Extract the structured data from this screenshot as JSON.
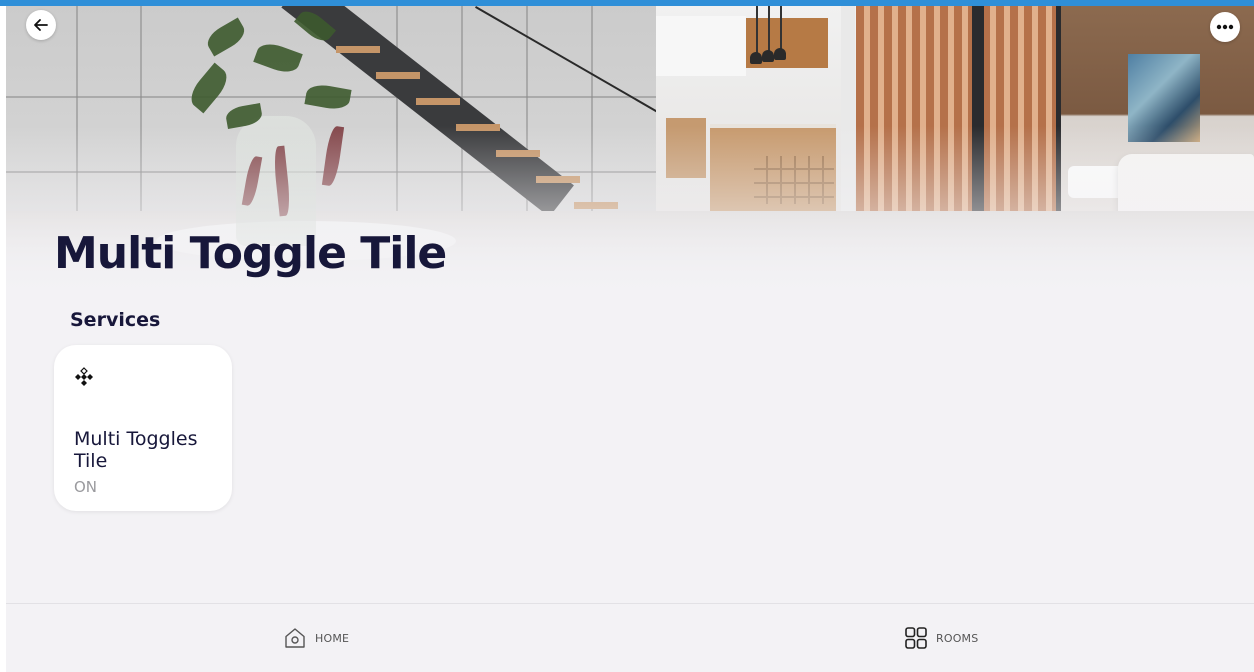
{
  "page": {
    "title": "Multi Toggle Tile",
    "section_title": "Services"
  },
  "header": {
    "back_icon": "arrow-left-icon",
    "more_icon": "more-horizontal-icon"
  },
  "services": [
    {
      "name": "Multi Toggles Tile",
      "state": "ON",
      "icon": "diamond-cluster-icon"
    }
  ],
  "bottom_nav": {
    "items": [
      {
        "label": "HOME",
        "icon": "home-icon"
      },
      {
        "label": "ROOMS",
        "icon": "grid-icon"
      }
    ]
  },
  "colors": {
    "accent_bar": "#2f8fd8",
    "title_text": "#17173a",
    "background": "#f3f2f5",
    "tile_background": "#ffffff",
    "state_text": "#9a9a9e"
  }
}
